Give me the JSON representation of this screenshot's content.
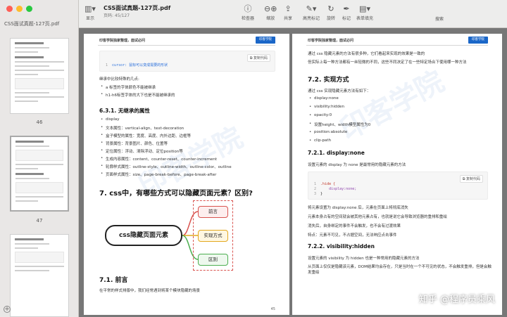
{
  "sidebar": {
    "title": "CSS面试真题-127页.pdf",
    "thumbnails": [
      {
        "label": "46"
      },
      {
        "label": "47"
      }
    ]
  },
  "toolbar": {
    "sidebar_label": "显示",
    "doc_title": "CSS面试真题-127页.pdf",
    "doc_subtitle": "页码: 45/127",
    "buttons": {
      "inspector": "检查器",
      "zoom": "缩放",
      "share": "共享",
      "highlight": "高亮标记",
      "rotate": "旋转",
      "markup": "标记",
      "form": "表单填充",
      "search": "搜索"
    }
  },
  "left_page": {
    "header": "印客学院独家整理，面试必问",
    "logo": "印客学院",
    "code1": {
      "copy": "复制代码",
      "line": "cursor: 鼠标可以变成需要的形状"
    },
    "inherit_intro": "继承中比较特殊的几点:",
    "inherit_items": [
      "a 标签的字体颜色不能被继承",
      "h1-h6标签字体的大下也是不能被继承的"
    ],
    "h631": "6.3.1. 无继承的属性",
    "noinherit_items": [
      "display",
      "文本属性：vertical-align、text-decoration",
      "盒子模型的属性：宽度、高度、内外边距、边框等",
      "背景属性：背景图片、颜色、位置等",
      "定位属性：浮动、清除浮动、定位position等",
      "生成内容属性：content、counter-reset、counter-increment",
      "轮廓样式属性：outline-style、outline-width、outline-color、outline",
      "页面样式属性：size、page-break-before、page-break-after"
    ],
    "h7": "7. css中，有哪些方式可以隐藏页面元素？区别?",
    "mindmap": {
      "main": "css隐藏页面元素",
      "nodes": [
        "前言",
        "实现方式",
        "区别"
      ]
    },
    "h71": "7.1. 前言",
    "h71_text": "在平常的样式排版中，我们经常遇到将某个模块隐藏的场景",
    "page_number": "45"
  },
  "right_page": {
    "header": "印客学院独家整理，面试必问",
    "logo": "印客学院",
    "intro1": "通过 css 隐藏元素的方法有很多种，它们看起来实现的效果是一致的",
    "intro2": "但实际上每一种方法都有一丝轻微的不同，这些不同决定了在一些特定场合下使用哪一种方法",
    "h72": "7.2. 实现方式",
    "h72_intro": "通过 css 实现隐藏元素方法有如下：",
    "methods": [
      "display:none",
      "visibility:hidden",
      "opacity:0",
      "设置height、width模型属性为0",
      "position:absolute",
      "clip-path"
    ],
    "h721": "7.2.1. display:none",
    "h721_text": "设置元素的 display 为 none 是最常用的隐藏元素的方法",
    "code2": {
      "copy": "复制代码",
      "line1": ".hide {",
      "line2": "    display:none;",
      "line3": "}"
    },
    "after_code": [
      "将元素设置为 display:none 后，元素在页面上将彻底消失",
      "元素本身占有的空间就会被其他元素占有，也就是说它会导致浏览器的重排和重绘",
      "消失后，自身绑定的事件不会触发，也不会有过渡效果",
      "特点：元素不可见，不占据空间，无法响应点击事件"
    ],
    "h722": "7.2.2. visibility:hidden",
    "h722_text1": "设置元素的 visibility 为 hidden 也是一种常用的隐藏元素的方法",
    "h722_text2": "从页面上仅仅是隐藏该元素，DOM结果均会存在，只是当时在一个不可见的状态，不会触发重排，但是会触发重绘",
    "overlay": "知乎 @程序员乘风"
  }
}
